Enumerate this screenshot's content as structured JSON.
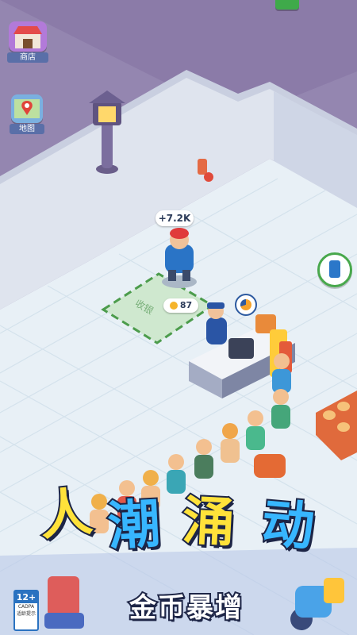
{
  "hud": {
    "shop_label": "商店",
    "map_label": "地图"
  },
  "world": {
    "income_bubble": "+7.2K",
    "counter_coins": "87",
    "register_text": "收银"
  },
  "banner": {
    "title_chars": [
      "人",
      "潮",
      "涌",
      "动"
    ],
    "subtitle": "金币暴增"
  },
  "rating": {
    "age": "12+",
    "line1": "CADPA",
    "line2": "适龄提示"
  },
  "colors": {
    "title_yellow": "#ffe23a",
    "title_blue": "#37b6ff",
    "outline": "#1d2546"
  }
}
